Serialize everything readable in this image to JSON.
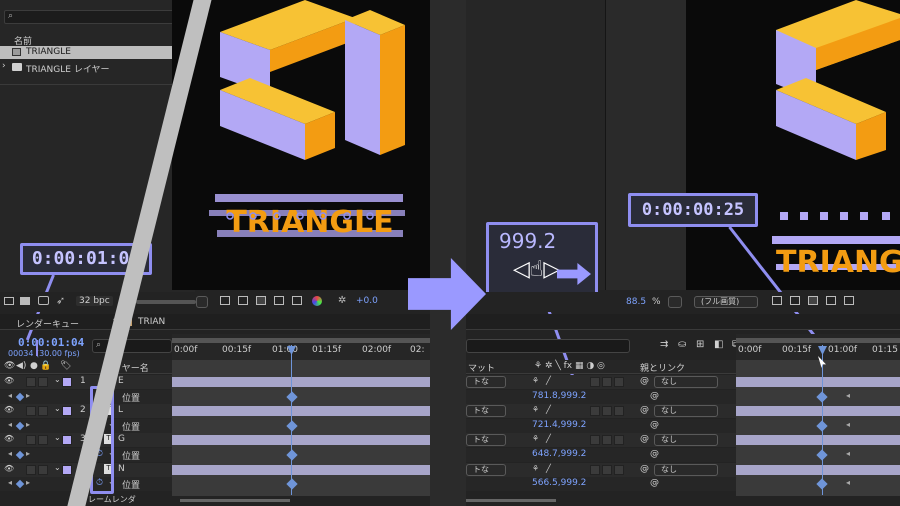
{
  "left": {
    "project": {
      "search_placeholder": "",
      "col_name": "名前",
      "items": [
        {
          "label": "TRIANGLE"
        },
        {
          "label": "TRIANGLE レイヤー"
        }
      ]
    },
    "comp_toolbar": {
      "bpc": "32 bpc"
    },
    "tabs": [
      {
        "label": "レンダーキュー"
      },
      {
        "label": "TRIAN"
      }
    ],
    "timecode": "0:00:01:04",
    "frames": "00034 (30.00 fps)",
    "layer_header": {
      "label": "レイヤー名"
    },
    "layers": [
      {
        "num": "1",
        "name": "E",
        "prop": "位置"
      },
      {
        "num": "2",
        "name": "L",
        "prop": "位置"
      },
      {
        "num": "3",
        "name": "G",
        "prop": "位置"
      },
      {
        "num": "4",
        "name": "N",
        "prop": "位置"
      }
    ],
    "footer_label": "フレームレンダ",
    "ruler": [
      "0:00f",
      "00:15f",
      "01:00",
      "01:15f",
      "02:00f",
      "02:"
    ],
    "callout_time": "0:00:01:04",
    "logo_text": "TRIANGLE"
  },
  "right": {
    "scrub_callout": {
      "value": "999.2"
    },
    "time_callout": "0:00:00:25",
    "viewer_zoom": "88.5",
    "viewer_zoom_unit": "%",
    "quality": "(フル画質)",
    "header": {
      "matte": "マット",
      "parent": "親とリンク"
    },
    "rows": [
      {
        "matte": "トな",
        "parent": "なし"
      },
      {
        "value": "781.8,999.2"
      },
      {
        "matte": "トな",
        "parent": "なし"
      },
      {
        "value": "721.4,999.2"
      },
      {
        "matte": "トな",
        "parent": "なし"
      },
      {
        "value": "648.7,999.2"
      },
      {
        "matte": "トな",
        "parent": "なし"
      },
      {
        "value": "566.5,999.2"
      }
    ],
    "ruler": [
      "0:00f",
      "00:15f",
      "01:00f",
      "01:15"
    ],
    "plus_value": "+0.0"
  },
  "colors": {
    "accent": "#8f8ef0",
    "arrow": "#9a99ff",
    "block_yellow": "#f7c234",
    "block_orange": "#f39c12",
    "block_lavender": "#b3a8f5",
    "timeline_blue": "#6f95d9"
  }
}
